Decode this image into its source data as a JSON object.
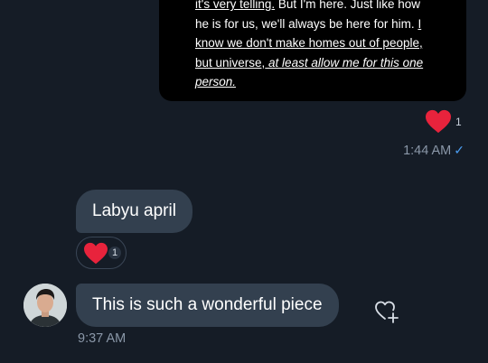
{
  "thread": {
    "outgoing": {
      "quote_lines": [
        [
          "it's very telling.",
          " But I'm here. Just like how"
        ],
        [
          "he is for us, we'll always be here for him. ",
          "I"
        ],
        [
          "know we don't make homes out of people,"
        ],
        [
          "but universe,",
          " at least allow me for this one"
        ],
        [
          "person."
        ]
      ],
      "reaction_count": "1",
      "time": "1:44 AM",
      "read_mark": "✓"
    },
    "incoming": [
      {
        "text": "Labyu april",
        "reaction_count": "1"
      },
      {
        "text": "This is such a wonderful piece",
        "time": "9:37 AM"
      }
    ]
  },
  "colors": {
    "background": "#151c26",
    "bubble": "#33404f",
    "heart": "#e8233c",
    "read_check": "#4b9df0",
    "meta_text": "#8a97a8"
  },
  "icons": {
    "reaction": "heart-icon",
    "add_reaction": "heart-plus-icon",
    "read": "check-icon"
  }
}
